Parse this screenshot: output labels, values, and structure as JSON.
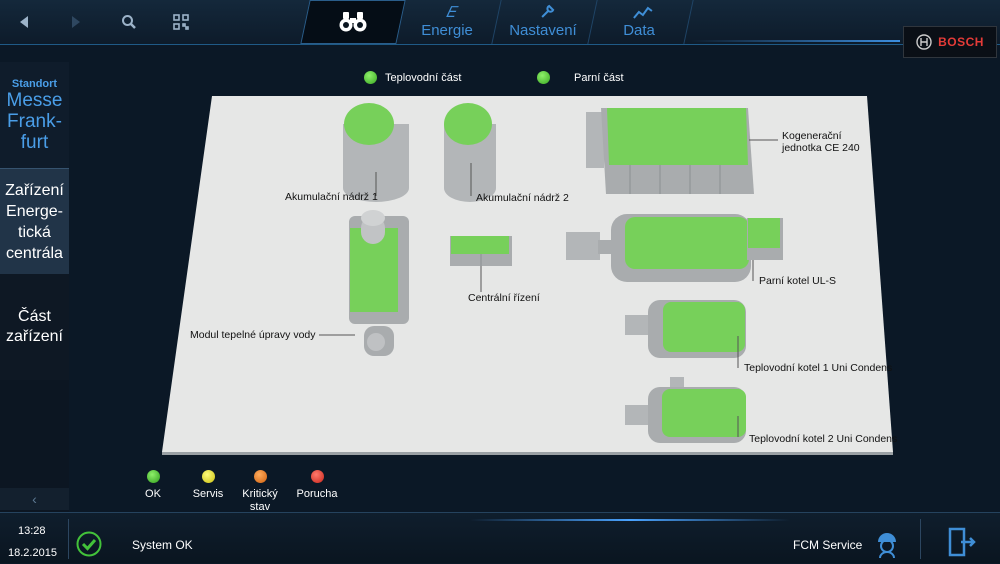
{
  "nav": {
    "tabs": [
      {
        "label": "",
        "icon": "binoculars-icon",
        "active": true
      },
      {
        "label": "Energie",
        "icon": "energy-leaf-icon"
      },
      {
        "label": "Nastavení",
        "icon": "wrench-icon"
      },
      {
        "label": "Data",
        "icon": "chart-line-icon"
      }
    ],
    "brand": "BOSCH"
  },
  "sidebar": {
    "standort_label": "Standort",
    "standort_value": "Messe Frank-furt",
    "zarizeni_label": "Zařízení Energe-tická centrála",
    "cast_label": "Část zařízení"
  },
  "legend_top": [
    {
      "label": "Teplovodní část",
      "color": "#52c234"
    },
    {
      "label": "Parní část",
      "color": "#52c234"
    }
  ],
  "plant": {
    "labels": {
      "tank1": "Akumulační nádrž 1",
      "tank2": "Akumulační nádrž 2",
      "chp": "Kogenerační jednotka CE 240",
      "central": "Centrální řízení",
      "steam": "Parní kotel UL-S",
      "water": "Modul tepelné úpravy vody",
      "boiler1": "Teplovodní kotel 1 Uni Condens",
      "boiler2": "Teplovodní kotel 2 Uni Condens"
    },
    "status_color": "#77d05a"
  },
  "status_legend": [
    {
      "label": "OK",
      "color": "#49c53a"
    },
    {
      "label": "Servis",
      "color": "#e8e020"
    },
    {
      "label": "Kritický stav",
      "color": "#e8741e"
    },
    {
      "label": "Porucha",
      "color": "#e23a2e"
    }
  ],
  "footer": {
    "time": "13:28",
    "date": "18.2.2015",
    "system_status": "System OK",
    "service": "FCM Service"
  }
}
